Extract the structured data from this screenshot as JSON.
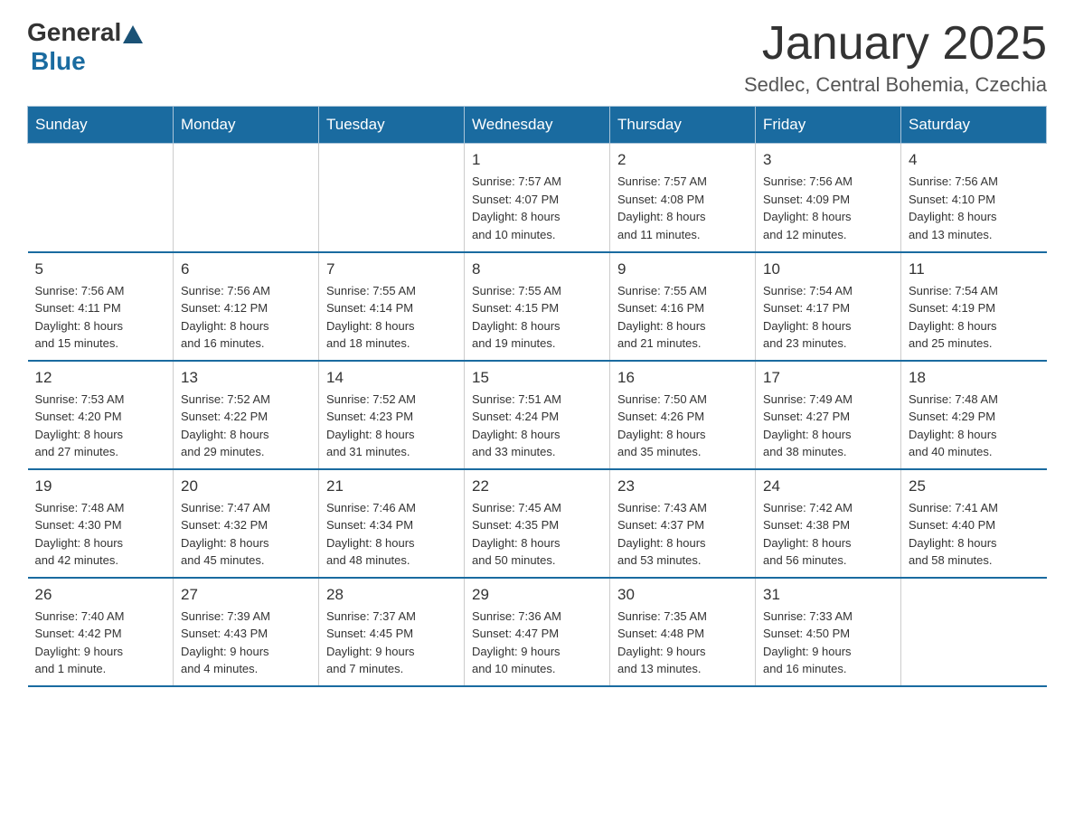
{
  "header": {
    "logo": {
      "general": "General",
      "blue": "Blue"
    },
    "title": "January 2025",
    "location": "Sedlec, Central Bohemia, Czechia"
  },
  "calendar": {
    "weekdays": [
      "Sunday",
      "Monday",
      "Tuesday",
      "Wednesday",
      "Thursday",
      "Friday",
      "Saturday"
    ],
    "weeks": [
      [
        {
          "day": "",
          "info": ""
        },
        {
          "day": "",
          "info": ""
        },
        {
          "day": "",
          "info": ""
        },
        {
          "day": "1",
          "info": "Sunrise: 7:57 AM\nSunset: 4:07 PM\nDaylight: 8 hours\nand 10 minutes."
        },
        {
          "day": "2",
          "info": "Sunrise: 7:57 AM\nSunset: 4:08 PM\nDaylight: 8 hours\nand 11 minutes."
        },
        {
          "day": "3",
          "info": "Sunrise: 7:56 AM\nSunset: 4:09 PM\nDaylight: 8 hours\nand 12 minutes."
        },
        {
          "day": "4",
          "info": "Sunrise: 7:56 AM\nSunset: 4:10 PM\nDaylight: 8 hours\nand 13 minutes."
        }
      ],
      [
        {
          "day": "5",
          "info": "Sunrise: 7:56 AM\nSunset: 4:11 PM\nDaylight: 8 hours\nand 15 minutes."
        },
        {
          "day": "6",
          "info": "Sunrise: 7:56 AM\nSunset: 4:12 PM\nDaylight: 8 hours\nand 16 minutes."
        },
        {
          "day": "7",
          "info": "Sunrise: 7:55 AM\nSunset: 4:14 PM\nDaylight: 8 hours\nand 18 minutes."
        },
        {
          "day": "8",
          "info": "Sunrise: 7:55 AM\nSunset: 4:15 PM\nDaylight: 8 hours\nand 19 minutes."
        },
        {
          "day": "9",
          "info": "Sunrise: 7:55 AM\nSunset: 4:16 PM\nDaylight: 8 hours\nand 21 minutes."
        },
        {
          "day": "10",
          "info": "Sunrise: 7:54 AM\nSunset: 4:17 PM\nDaylight: 8 hours\nand 23 minutes."
        },
        {
          "day": "11",
          "info": "Sunrise: 7:54 AM\nSunset: 4:19 PM\nDaylight: 8 hours\nand 25 minutes."
        }
      ],
      [
        {
          "day": "12",
          "info": "Sunrise: 7:53 AM\nSunset: 4:20 PM\nDaylight: 8 hours\nand 27 minutes."
        },
        {
          "day": "13",
          "info": "Sunrise: 7:52 AM\nSunset: 4:22 PM\nDaylight: 8 hours\nand 29 minutes."
        },
        {
          "day": "14",
          "info": "Sunrise: 7:52 AM\nSunset: 4:23 PM\nDaylight: 8 hours\nand 31 minutes."
        },
        {
          "day": "15",
          "info": "Sunrise: 7:51 AM\nSunset: 4:24 PM\nDaylight: 8 hours\nand 33 minutes."
        },
        {
          "day": "16",
          "info": "Sunrise: 7:50 AM\nSunset: 4:26 PM\nDaylight: 8 hours\nand 35 minutes."
        },
        {
          "day": "17",
          "info": "Sunrise: 7:49 AM\nSunset: 4:27 PM\nDaylight: 8 hours\nand 38 minutes."
        },
        {
          "day": "18",
          "info": "Sunrise: 7:48 AM\nSunset: 4:29 PM\nDaylight: 8 hours\nand 40 minutes."
        }
      ],
      [
        {
          "day": "19",
          "info": "Sunrise: 7:48 AM\nSunset: 4:30 PM\nDaylight: 8 hours\nand 42 minutes."
        },
        {
          "day": "20",
          "info": "Sunrise: 7:47 AM\nSunset: 4:32 PM\nDaylight: 8 hours\nand 45 minutes."
        },
        {
          "day": "21",
          "info": "Sunrise: 7:46 AM\nSunset: 4:34 PM\nDaylight: 8 hours\nand 48 minutes."
        },
        {
          "day": "22",
          "info": "Sunrise: 7:45 AM\nSunset: 4:35 PM\nDaylight: 8 hours\nand 50 minutes."
        },
        {
          "day": "23",
          "info": "Sunrise: 7:43 AM\nSunset: 4:37 PM\nDaylight: 8 hours\nand 53 minutes."
        },
        {
          "day": "24",
          "info": "Sunrise: 7:42 AM\nSunset: 4:38 PM\nDaylight: 8 hours\nand 56 minutes."
        },
        {
          "day": "25",
          "info": "Sunrise: 7:41 AM\nSunset: 4:40 PM\nDaylight: 8 hours\nand 58 minutes."
        }
      ],
      [
        {
          "day": "26",
          "info": "Sunrise: 7:40 AM\nSunset: 4:42 PM\nDaylight: 9 hours\nand 1 minute."
        },
        {
          "day": "27",
          "info": "Sunrise: 7:39 AM\nSunset: 4:43 PM\nDaylight: 9 hours\nand 4 minutes."
        },
        {
          "day": "28",
          "info": "Sunrise: 7:37 AM\nSunset: 4:45 PM\nDaylight: 9 hours\nand 7 minutes."
        },
        {
          "day": "29",
          "info": "Sunrise: 7:36 AM\nSunset: 4:47 PM\nDaylight: 9 hours\nand 10 minutes."
        },
        {
          "day": "30",
          "info": "Sunrise: 7:35 AM\nSunset: 4:48 PM\nDaylight: 9 hours\nand 13 minutes."
        },
        {
          "day": "31",
          "info": "Sunrise: 7:33 AM\nSunset: 4:50 PM\nDaylight: 9 hours\nand 16 minutes."
        },
        {
          "day": "",
          "info": ""
        }
      ]
    ]
  }
}
